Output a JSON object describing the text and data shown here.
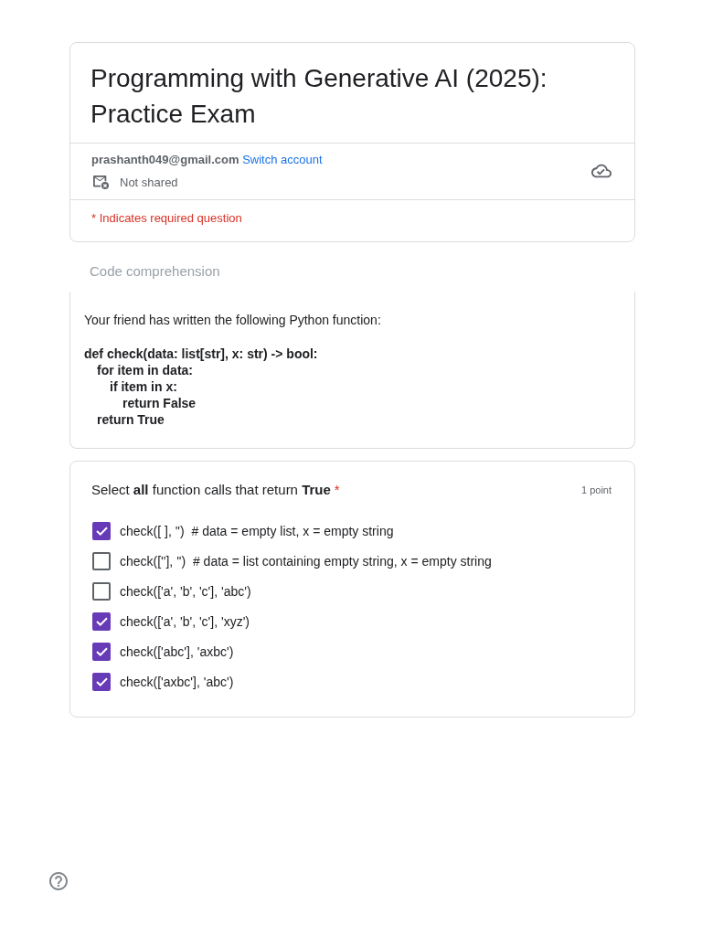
{
  "header": {
    "title": "Programming with Generative AI (2025): Practice Exam",
    "account_email": "prashanth049@gmail.com",
    "switch_link": "Switch account",
    "sharing": "Not shared",
    "required_note": "* Indicates required question"
  },
  "section": {
    "title": "Code comprehension",
    "description": "Your friend has written the following Python function:",
    "code": [
      {
        "text": "def check(data: list[str], x: str) -> bool:",
        "children": [
          {
            "text": "for item in data:",
            "children": [
              {
                "text": "if item in x:",
                "children": [
                  {
                    "text": "return False"
                  }
                ]
              }
            ]
          },
          {
            "text": "return True"
          }
        ]
      }
    ]
  },
  "question": {
    "title": "Select **all** function calls that return **True**",
    "required_mark": "*",
    "points": "1 point",
    "options": [
      {
        "label": "check([ ], '')  # data = empty list, x = empty string",
        "checked": true
      },
      {
        "label": "check([''], '')  # data = list containing empty string, x = empty string",
        "checked": false
      },
      {
        "label": "check(['a', 'b', 'c'], 'abc')",
        "checked": false
      },
      {
        "label": "check(['a', 'b', 'c'], 'xyz')",
        "checked": true
      },
      {
        "label": "check(['abc'], 'axbc')",
        "checked": true
      },
      {
        "label": "check(['axbc'], 'abc')",
        "checked": true
      }
    ]
  }
}
